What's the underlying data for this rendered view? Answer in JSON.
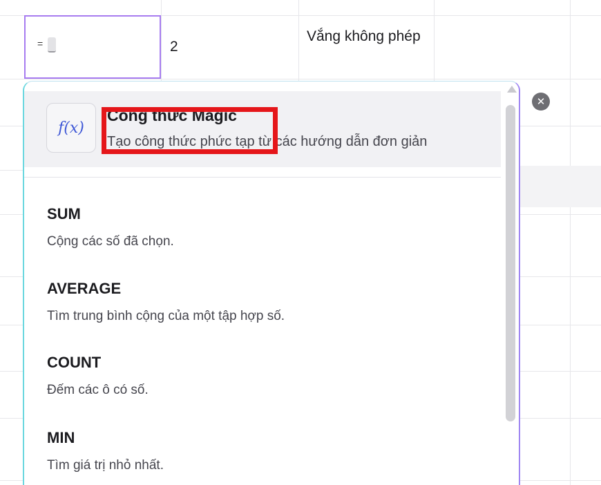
{
  "sheet": {
    "active_cell_formula_prefix": "=",
    "cell_value_number": "2",
    "cell_value_status": "Vắng không phép"
  },
  "magic_formula": {
    "title": "Công thức Magic",
    "description": "Tạo công thức phức tạp từ các hướng dẫn đơn giản",
    "icon": "f(x)"
  },
  "functions": [
    {
      "name": "SUM",
      "description": "Cộng các số đã chọn."
    },
    {
      "name": "AVERAGE",
      "description": "Tìm trung bình cộng của một tập hợp số."
    },
    {
      "name": "COUNT",
      "description": "Đếm các ô có số."
    },
    {
      "name": "MIN",
      "description": "Tìm giá trị nhỏ nhất."
    }
  ],
  "colors": {
    "active_cell_border": "#a77cf0",
    "highlight_border": "#e5161a",
    "fx_icon": "#3f58d6"
  }
}
